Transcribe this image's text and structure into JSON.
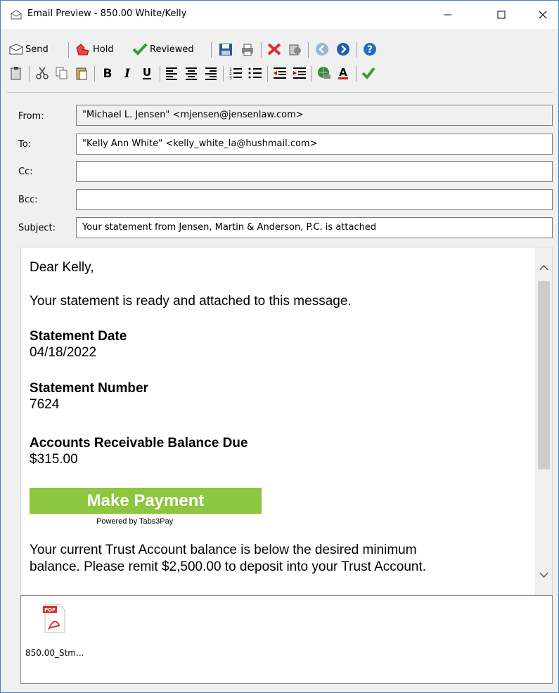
{
  "window": {
    "title": "Email Preview - 850.00 White/Kelly",
    "minimize": "—",
    "maximize": "☐",
    "close": "✕"
  },
  "toolbar1": {
    "send_label": "Send",
    "hold_label": "Hold",
    "reviewed_label": "Reviewed"
  },
  "fields": {
    "from_label": "From:",
    "from_value": "\"Michael L. Jensen\" <mjensen@jensenlaw.com>",
    "to_label": "To:",
    "to_value": "\"Kelly Ann White\" <kelly_white_la@hushmail.com>",
    "cc_label": "Cc:",
    "cc_value": "",
    "bcc_label": "Bcc:",
    "bcc_value": "",
    "subject_label": "Subject:",
    "subject_value": "Your statement from Jensen, Martin & Anderson, P.C. is attached"
  },
  "body": {
    "greeting": "Dear Kelly,",
    "intro": "Your statement is ready and attached to this message.",
    "date_heading": "Statement Date",
    "date_value": "04/18/2022",
    "number_heading": "Statement Number",
    "number_value": "7624",
    "balance_heading": "Accounts Receivable Balance Due",
    "balance_value": "$315.00",
    "pay_button": "Make Payment",
    "powered_by": "Powered by Tabs3Pay",
    "trust_line1": "Your current Trust Account balance is below the desired minimum",
    "trust_line2": "balance. Please remit $2,500.00 to deposit into your Trust Account."
  },
  "attachment": {
    "type_label": "PDF",
    "name": "850.00_Stm..."
  },
  "colors": {
    "pay_button": "#8dc63f",
    "window_border": "#4a7ebb"
  }
}
